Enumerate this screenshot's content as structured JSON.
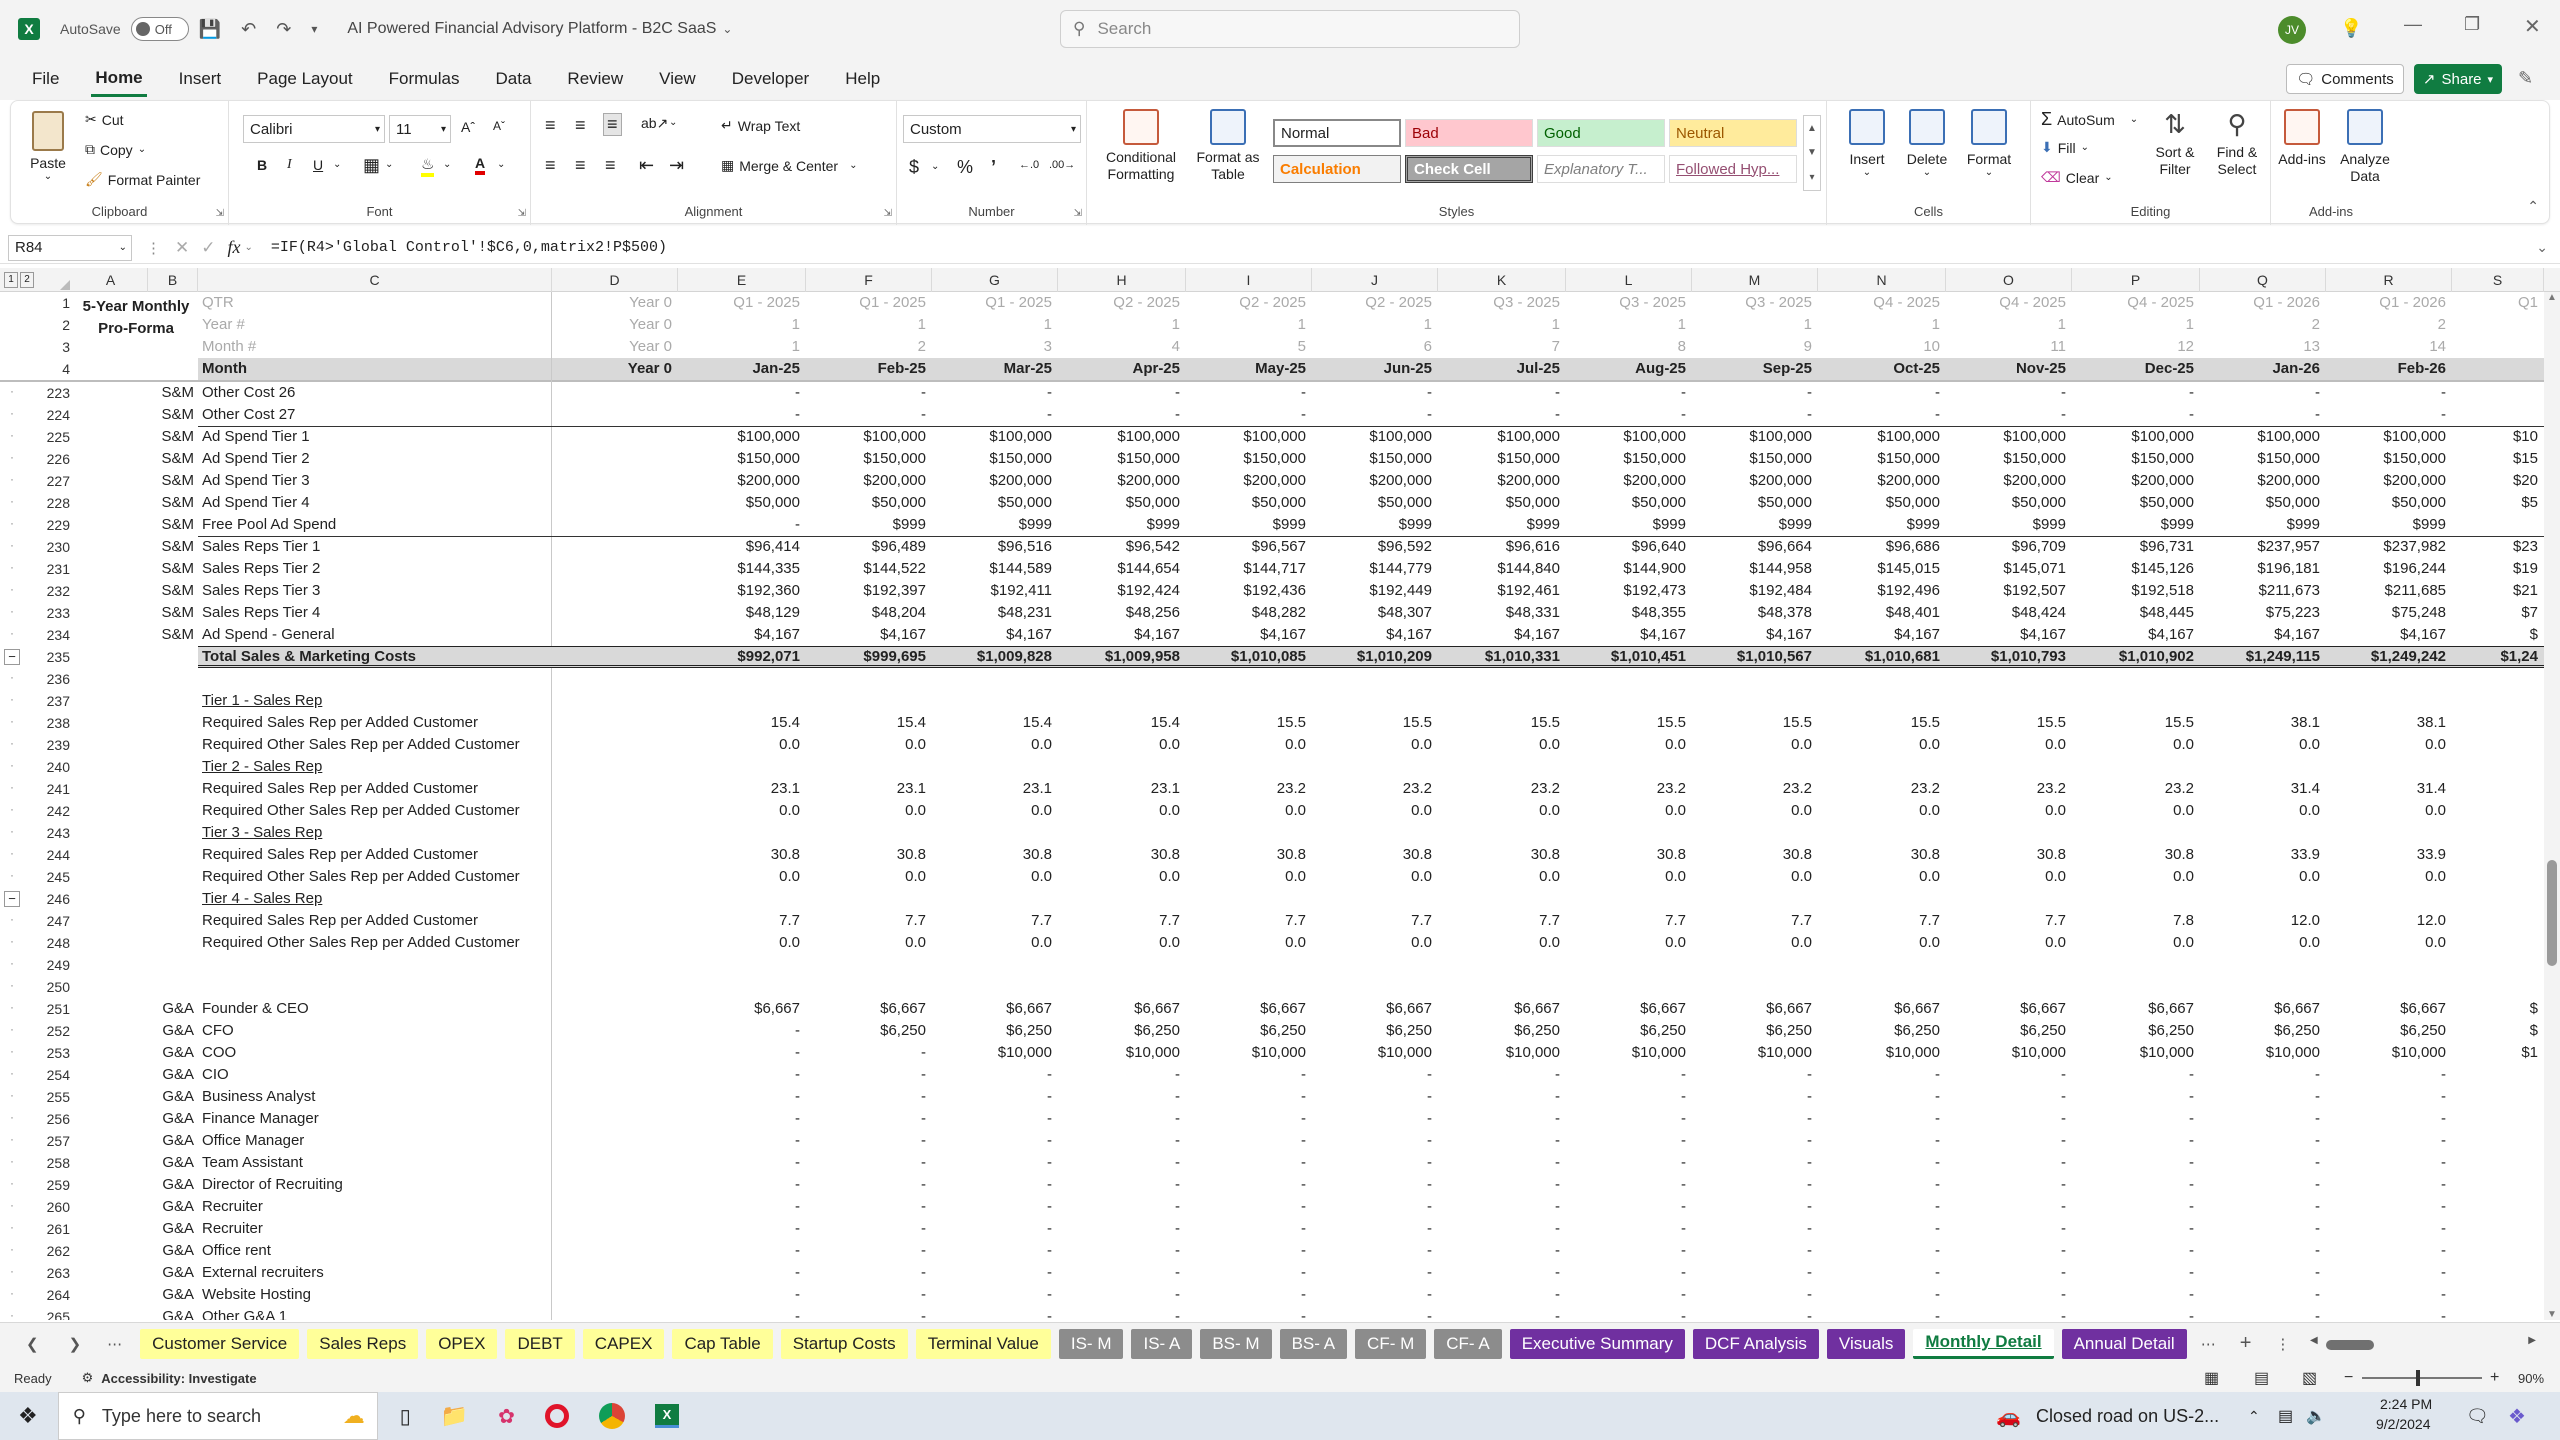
{
  "app": {
    "autosave_label": "AutoSave",
    "autosave_state": "Off",
    "title": "AI Powered Financial Advisory Platform - B2C SaaS",
    "search_placeholder": "Search",
    "user_initials": "JV"
  },
  "menu": [
    "File",
    "Home",
    "Insert",
    "Page Layout",
    "Formulas",
    "Data",
    "Review",
    "View",
    "Developer",
    "Help"
  ],
  "menu_active": "Home",
  "actions": {
    "comments": "Comments",
    "share": "Share"
  },
  "ribbon": {
    "clipboard": {
      "paste": "Paste",
      "cut": "Cut",
      "copy": "Copy",
      "format_painter": "Format Painter",
      "label": "Clipboard"
    },
    "font": {
      "name": "Calibri",
      "size": "11",
      "label": "Font"
    },
    "alignment": {
      "wrap": "Wrap Text",
      "merge": "Merge & Center",
      "label": "Alignment"
    },
    "number": {
      "format": "Custom",
      "label": "Number"
    },
    "styles": {
      "cond": "Conditional Formatting",
      "table": "Format as Table",
      "label": "Styles",
      "cells": [
        {
          "t": "Normal",
          "bg": "#ffffff",
          "fg": "#000000"
        },
        {
          "t": "Bad",
          "bg": "#ffc7ce",
          "fg": "#9c0006"
        },
        {
          "t": "Good",
          "bg": "#c6efce",
          "fg": "#006100"
        },
        {
          "t": "Neutral",
          "bg": "#ffeb9c",
          "fg": "#9c5700"
        },
        {
          "t": "Calculation",
          "bg": "#f2f2f2",
          "fg": "#fa7d00"
        },
        {
          "t": "Check Cell",
          "bg": "#a5a5a5",
          "fg": "#ffffff"
        },
        {
          "t": "Explanatory T...",
          "bg": "#ffffff",
          "fg": "#7f7f7f"
        },
        {
          "t": "Followed Hyp...",
          "bg": "#ffffff",
          "fg": "#954f72"
        }
      ]
    },
    "cells": {
      "insert": "Insert",
      "delete": "Delete",
      "format": "Format",
      "label": "Cells"
    },
    "editing": {
      "autosum": "AutoSum",
      "fill": "Fill",
      "clear": "Clear",
      "sort": "Sort & Filter",
      "find": "Find & Select",
      "label": "Editing"
    },
    "addins": {
      "addins": "Add-ins",
      "analyze": "Analyze Data",
      "label": "Add-ins"
    }
  },
  "formula": {
    "namebox": "R84",
    "fx": "fx",
    "text": "=IF(R4>'Global Control'!$C6,0,matrix2!P$500)"
  },
  "columns": [
    "A",
    "B",
    "C",
    "D",
    "E",
    "F",
    "G",
    "H",
    "I",
    "J",
    "K",
    "L",
    "M",
    "N",
    "O",
    "P",
    "Q",
    "R",
    "S"
  ],
  "header": {
    "title_line1": "5-Year Monthly",
    "title_line2": "Pro-Forma",
    "qtr_label": "QTR",
    "year_label": "Year #",
    "month_num_label": "Month #",
    "month_label": "Month",
    "d_qtr": "Year 0",
    "d_year": "Year 0",
    "d_monthnum": "Year 0",
    "d_month": "Year 0",
    "qtr": [
      "Q1 - 2025",
      "Q1 - 2025",
      "Q1 - 2025",
      "Q2 - 2025",
      "Q2 - 2025",
      "Q2 - 2025",
      "Q3 - 2025",
      "Q3 - 2025",
      "Q3 - 2025",
      "Q4 - 2025",
      "Q4 - 2025",
      "Q4 - 2025",
      "Q1 - 2026",
      "Q1 - 2026",
      "Q1"
    ],
    "year": [
      "1",
      "1",
      "1",
      "1",
      "1",
      "1",
      "1",
      "1",
      "1",
      "1",
      "1",
      "1",
      "2",
      "2",
      ""
    ],
    "monthnum": [
      "1",
      "2",
      "3",
      "4",
      "5",
      "6",
      "7",
      "8",
      "9",
      "10",
      "11",
      "12",
      "13",
      "14",
      ""
    ],
    "month": [
      "Jan-25",
      "Feb-25",
      "Mar-25",
      "Apr-25",
      "May-25",
      "Jun-25",
      "Jul-25",
      "Aug-25",
      "Sep-25",
      "Oct-25",
      "Nov-25",
      "Dec-25",
      "Jan-26",
      "Feb-26",
      ""
    ]
  },
  "rows": [
    {
      "n": "223",
      "b": "S&M",
      "c": "Other Cost 26",
      "v": [
        "-",
        "-",
        "-",
        "-",
        "-",
        "-",
        "-",
        "-",
        "-",
        "-",
        "-",
        "-",
        "-",
        "-",
        ""
      ]
    },
    {
      "n": "224",
      "b": "S&M",
      "c": "Other Cost 27",
      "v": [
        "-",
        "-",
        "-",
        "-",
        "-",
        "-",
        "-",
        "-",
        "-",
        "-",
        "-",
        "-",
        "-",
        "-",
        ""
      ]
    },
    {
      "n": "225",
      "b": "S&M",
      "c": "Ad Spend Tier 1",
      "v": [
        "$100,000",
        "$100,000",
        "$100,000",
        "$100,000",
        "$100,000",
        "$100,000",
        "$100,000",
        "$100,000",
        "$100,000",
        "$100,000",
        "$100,000",
        "$100,000",
        "$100,000",
        "$100,000",
        "$10"
      ]
    },
    {
      "n": "226",
      "b": "S&M",
      "c": "Ad Spend Tier 2",
      "v": [
        "$150,000",
        "$150,000",
        "$150,000",
        "$150,000",
        "$150,000",
        "$150,000",
        "$150,000",
        "$150,000",
        "$150,000",
        "$150,000",
        "$150,000",
        "$150,000",
        "$150,000",
        "$150,000",
        "$15"
      ]
    },
    {
      "n": "227",
      "b": "S&M",
      "c": "Ad Spend Tier 3",
      "v": [
        "$200,000",
        "$200,000",
        "$200,000",
        "$200,000",
        "$200,000",
        "$200,000",
        "$200,000",
        "$200,000",
        "$200,000",
        "$200,000",
        "$200,000",
        "$200,000",
        "$200,000",
        "$200,000",
        "$20"
      ]
    },
    {
      "n": "228",
      "b": "S&M",
      "c": "Ad Spend Tier 4",
      "v": [
        "$50,000",
        "$50,000",
        "$50,000",
        "$50,000",
        "$50,000",
        "$50,000",
        "$50,000",
        "$50,000",
        "$50,000",
        "$50,000",
        "$50,000",
        "$50,000",
        "$50,000",
        "$50,000",
        "$5"
      ]
    },
    {
      "n": "229",
      "b": "S&M",
      "c": "Free Pool Ad Spend",
      "v": [
        "-",
        "$999",
        "$999",
        "$999",
        "$999",
        "$999",
        "$999",
        "$999",
        "$999",
        "$999",
        "$999",
        "$999",
        "$999",
        "$999",
        ""
      ]
    },
    {
      "n": "230",
      "b": "S&M",
      "c": "Sales Reps Tier 1",
      "v": [
        "$96,414",
        "$96,489",
        "$96,516",
        "$96,542",
        "$96,567",
        "$96,592",
        "$96,616",
        "$96,640",
        "$96,664",
        "$96,686",
        "$96,709",
        "$96,731",
        "$237,957",
        "$237,982",
        "$23"
      ]
    },
    {
      "n": "231",
      "b": "S&M",
      "c": "Sales Reps Tier 2",
      "v": [
        "$144,335",
        "$144,522",
        "$144,589",
        "$144,654",
        "$144,717",
        "$144,779",
        "$144,840",
        "$144,900",
        "$144,958",
        "$145,015",
        "$145,071",
        "$145,126",
        "$196,181",
        "$196,244",
        "$19"
      ]
    },
    {
      "n": "232",
      "b": "S&M",
      "c": "Sales Reps Tier 3",
      "v": [
        "$192,360",
        "$192,397",
        "$192,411",
        "$192,424",
        "$192,436",
        "$192,449",
        "$192,461",
        "$192,473",
        "$192,484",
        "$192,496",
        "$192,507",
        "$192,518",
        "$211,673",
        "$211,685",
        "$21"
      ]
    },
    {
      "n": "233",
      "b": "S&M",
      "c": "Sales Reps Tier 4",
      "v": [
        "$48,129",
        "$48,204",
        "$48,231",
        "$48,256",
        "$48,282",
        "$48,307",
        "$48,331",
        "$48,355",
        "$48,378",
        "$48,401",
        "$48,424",
        "$48,445",
        "$75,223",
        "$75,248",
        "$7"
      ]
    },
    {
      "n": "234",
      "b": "S&M",
      "c": "Ad Spend - General",
      "v": [
        "$4,167",
        "$4,167",
        "$4,167",
        "$4,167",
        "$4,167",
        "$4,167",
        "$4,167",
        "$4,167",
        "$4,167",
        "$4,167",
        "$4,167",
        "$4,167",
        "$4,167",
        "$4,167",
        "$"
      ]
    },
    {
      "n": "235",
      "b": "",
      "c": "Total Sales & Marketing Costs",
      "total": true,
      "v": [
        "$992,071",
        "$999,695",
        "$1,009,828",
        "$1,009,958",
        "$1,010,085",
        "$1,010,209",
        "$1,010,331",
        "$1,010,451",
        "$1,010,567",
        "$1,010,681",
        "$1,010,793",
        "$1,010,902",
        "$1,249,115",
        "$1,249,242",
        "$1,24"
      ]
    },
    {
      "n": "236",
      "b": "",
      "c": "",
      "v": []
    },
    {
      "n": "237",
      "b": "",
      "c": "Tier 1 - Sales Rep",
      "u": true,
      "v": []
    },
    {
      "n": "238",
      "b": "",
      "c": "Required Sales Rep per Added Customer",
      "v": [
        "15.4",
        "15.4",
        "15.4",
        "15.4",
        "15.5",
        "15.5",
        "15.5",
        "15.5",
        "15.5",
        "15.5",
        "15.5",
        "15.5",
        "38.1",
        "38.1",
        ""
      ]
    },
    {
      "n": "239",
      "b": "",
      "c": "Required Other Sales Rep per Added Customer",
      "v": [
        "0.0",
        "0.0",
        "0.0",
        "0.0",
        "0.0",
        "0.0",
        "0.0",
        "0.0",
        "0.0",
        "0.0",
        "0.0",
        "0.0",
        "0.0",
        "0.0",
        ""
      ]
    },
    {
      "n": "240",
      "b": "",
      "c": "Tier 2 - Sales Rep",
      "u": true,
      "v": []
    },
    {
      "n": "241",
      "b": "",
      "c": "Required Sales Rep per Added Customer",
      "v": [
        "23.1",
        "23.1",
        "23.1",
        "23.1",
        "23.2",
        "23.2",
        "23.2",
        "23.2",
        "23.2",
        "23.2",
        "23.2",
        "23.2",
        "31.4",
        "31.4",
        ""
      ]
    },
    {
      "n": "242",
      "b": "",
      "c": "Required Other Sales Rep per Added Customer",
      "v": [
        "0.0",
        "0.0",
        "0.0",
        "0.0",
        "0.0",
        "0.0",
        "0.0",
        "0.0",
        "0.0",
        "0.0",
        "0.0",
        "0.0",
        "0.0",
        "0.0",
        ""
      ]
    },
    {
      "n": "243",
      "b": "",
      "c": "Tier 3 - Sales Rep",
      "u": true,
      "v": []
    },
    {
      "n": "244",
      "b": "",
      "c": "Required Sales Rep per Added Customer",
      "v": [
        "30.8",
        "30.8",
        "30.8",
        "30.8",
        "30.8",
        "30.8",
        "30.8",
        "30.8",
        "30.8",
        "30.8",
        "30.8",
        "30.8",
        "33.9",
        "33.9",
        ""
      ]
    },
    {
      "n": "245",
      "b": "",
      "c": "Required Other Sales Rep per Added Customer",
      "v": [
        "0.0",
        "0.0",
        "0.0",
        "0.0",
        "0.0",
        "0.0",
        "0.0",
        "0.0",
        "0.0",
        "0.0",
        "0.0",
        "0.0",
        "0.0",
        "0.0",
        ""
      ]
    },
    {
      "n": "246",
      "b": "",
      "c": "Tier 4 - Sales Rep",
      "u": true,
      "v": []
    },
    {
      "n": "247",
      "b": "",
      "c": "Required Sales Rep per Added Customer",
      "v": [
        "7.7",
        "7.7",
        "7.7",
        "7.7",
        "7.7",
        "7.7",
        "7.7",
        "7.7",
        "7.7",
        "7.7",
        "7.7",
        "7.8",
        "12.0",
        "12.0",
        ""
      ]
    },
    {
      "n": "248",
      "b": "",
      "c": "Required Other Sales Rep per Added Customer",
      "v": [
        "0.0",
        "0.0",
        "0.0",
        "0.0",
        "0.0",
        "0.0",
        "0.0",
        "0.0",
        "0.0",
        "0.0",
        "0.0",
        "0.0",
        "0.0",
        "0.0",
        ""
      ]
    },
    {
      "n": "249",
      "b": "",
      "c": "",
      "v": []
    },
    {
      "n": "250",
      "b": "",
      "c": "",
      "v": []
    },
    {
      "n": "251",
      "b": "G&A",
      "c": "Founder & CEO",
      "v": [
        "$6,667",
        "$6,667",
        "$6,667",
        "$6,667",
        "$6,667",
        "$6,667",
        "$6,667",
        "$6,667",
        "$6,667",
        "$6,667",
        "$6,667",
        "$6,667",
        "$6,667",
        "$6,667",
        "$"
      ]
    },
    {
      "n": "252",
      "b": "G&A",
      "c": "CFO",
      "v": [
        "-",
        "$6,250",
        "$6,250",
        "$6,250",
        "$6,250",
        "$6,250",
        "$6,250",
        "$6,250",
        "$6,250",
        "$6,250",
        "$6,250",
        "$6,250",
        "$6,250",
        "$6,250",
        "$"
      ]
    },
    {
      "n": "253",
      "b": "G&A",
      "c": "COO",
      "v": [
        "-",
        "-",
        "$10,000",
        "$10,000",
        "$10,000",
        "$10,000",
        "$10,000",
        "$10,000",
        "$10,000",
        "$10,000",
        "$10,000",
        "$10,000",
        "$10,000",
        "$10,000",
        "$1"
      ]
    },
    {
      "n": "254",
      "b": "G&A",
      "c": "CIO",
      "v": [
        "-",
        "-",
        "-",
        "-",
        "-",
        "-",
        "-",
        "-",
        "-",
        "-",
        "-",
        "-",
        "-",
        "-",
        ""
      ]
    },
    {
      "n": "255",
      "b": "G&A",
      "c": "Business Analyst",
      "v": [
        "-",
        "-",
        "-",
        "-",
        "-",
        "-",
        "-",
        "-",
        "-",
        "-",
        "-",
        "-",
        "-",
        "-",
        ""
      ]
    },
    {
      "n": "256",
      "b": "G&A",
      "c": "Finance Manager",
      "v": [
        "-",
        "-",
        "-",
        "-",
        "-",
        "-",
        "-",
        "-",
        "-",
        "-",
        "-",
        "-",
        "-",
        "-",
        ""
      ]
    },
    {
      "n": "257",
      "b": "G&A",
      "c": "Office Manager",
      "v": [
        "-",
        "-",
        "-",
        "-",
        "-",
        "-",
        "-",
        "-",
        "-",
        "-",
        "-",
        "-",
        "-",
        "-",
        ""
      ]
    },
    {
      "n": "258",
      "b": "G&A",
      "c": "Team Assistant",
      "v": [
        "-",
        "-",
        "-",
        "-",
        "-",
        "-",
        "-",
        "-",
        "-",
        "-",
        "-",
        "-",
        "-",
        "-",
        ""
      ]
    },
    {
      "n": "259",
      "b": "G&A",
      "c": "Director of Recruiting",
      "v": [
        "-",
        "-",
        "-",
        "-",
        "-",
        "-",
        "-",
        "-",
        "-",
        "-",
        "-",
        "-",
        "-",
        "-",
        ""
      ]
    },
    {
      "n": "260",
      "b": "G&A",
      "c": "Recruiter",
      "v": [
        "-",
        "-",
        "-",
        "-",
        "-",
        "-",
        "-",
        "-",
        "-",
        "-",
        "-",
        "-",
        "-",
        "-",
        ""
      ]
    },
    {
      "n": "261",
      "b": "G&A",
      "c": "Recruiter",
      "v": [
        "-",
        "-",
        "-",
        "-",
        "-",
        "-",
        "-",
        "-",
        "-",
        "-",
        "-",
        "-",
        "-",
        "-",
        ""
      ]
    },
    {
      "n": "262",
      "b": "G&A",
      "c": "Office rent",
      "v": [
        "-",
        "-",
        "-",
        "-",
        "-",
        "-",
        "-",
        "-",
        "-",
        "-",
        "-",
        "-",
        "-",
        "-",
        ""
      ]
    },
    {
      "n": "263",
      "b": "G&A",
      "c": "External recruiters",
      "v": [
        "-",
        "-",
        "-",
        "-",
        "-",
        "-",
        "-",
        "-",
        "-",
        "-",
        "-",
        "-",
        "-",
        "-",
        ""
      ]
    },
    {
      "n": "264",
      "b": "G&A",
      "c": "Website Hosting",
      "v": [
        "-",
        "-",
        "-",
        "-",
        "-",
        "-",
        "-",
        "-",
        "-",
        "-",
        "-",
        "-",
        "-",
        "-",
        ""
      ]
    },
    {
      "n": "265",
      "b": "G&A",
      "c": "Other G&A 1",
      "v": [
        "-",
        "-",
        "-",
        "-",
        "-",
        "-",
        "-",
        "-",
        "-",
        "-",
        "-",
        "-",
        "-",
        "-",
        ""
      ]
    }
  ],
  "tabs": [
    {
      "t": "Customer Service",
      "bg": "#ffff99",
      "fg": "#222"
    },
    {
      "t": "Sales Reps",
      "bg": "#ffff99",
      "fg": "#222"
    },
    {
      "t": "OPEX",
      "bg": "#ffff99",
      "fg": "#222"
    },
    {
      "t": "DEBT",
      "bg": "#ffff99",
      "fg": "#222"
    },
    {
      "t": "CAPEX",
      "bg": "#ffff99",
      "fg": "#222"
    },
    {
      "t": "Cap Table",
      "bg": "#ffff99",
      "fg": "#222"
    },
    {
      "t": "Startup Costs",
      "bg": "#ffff99",
      "fg": "#222"
    },
    {
      "t": "Terminal Value",
      "bg": "#ffff99",
      "fg": "#222"
    },
    {
      "t": "IS- M",
      "bg": "#8c8c8c",
      "fg": "#fff"
    },
    {
      "t": "IS- A",
      "bg": "#8c8c8c",
      "fg": "#fff"
    },
    {
      "t": "BS- M",
      "bg": "#8c8c8c",
      "fg": "#fff"
    },
    {
      "t": "BS- A",
      "bg": "#8c8c8c",
      "fg": "#fff"
    },
    {
      "t": "CF- M",
      "bg": "#8c8c8c",
      "fg": "#fff"
    },
    {
      "t": "CF- A",
      "bg": "#8c8c8c",
      "fg": "#fff"
    },
    {
      "t": "Executive Summary",
      "bg": "#7030a0",
      "fg": "#fff"
    },
    {
      "t": "DCF Analysis",
      "bg": "#7030a0",
      "fg": "#fff"
    },
    {
      "t": "Visuals",
      "bg": "#7030a0",
      "fg": "#fff"
    },
    {
      "t": "Monthly Detail",
      "bg": "#ffffff",
      "fg": "#222",
      "active": true
    },
    {
      "t": "Annual Detail",
      "bg": "#7030a0",
      "fg": "#fff"
    }
  ],
  "status": {
    "ready": "Ready",
    "accessibility": "Accessibility: Investigate",
    "zoom": "90%"
  },
  "taskbar": {
    "search_placeholder": "Type here to search",
    "news": "Closed road on US-2...",
    "time": "2:24 PM",
    "date": "9/2/2024"
  }
}
